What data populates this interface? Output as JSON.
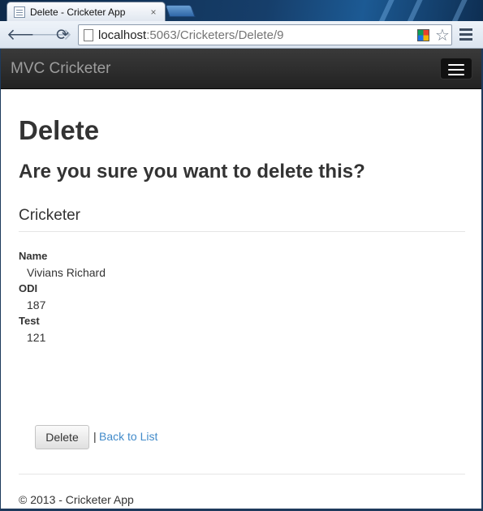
{
  "browser": {
    "tab_title": "Delete - Cricketer App",
    "tab_close": "×",
    "url_host": "localhost",
    "url_path": ":5063/Cricketers/Delete/9",
    "back_glyph": "🡐",
    "forward_glyph": "🡒",
    "reload_glyph": "⟳",
    "star_glyph": "☆",
    "icons": [
      "page-icon",
      "back-arrow-icon",
      "forward-arrow-icon",
      "reload-icon",
      "extension-icon",
      "bookmark-star-icon",
      "menu-icon"
    ]
  },
  "navbar": {
    "brand": "MVC Cricketer",
    "toggle_icon": "hamburger-menu-icon",
    "background": "#222222",
    "brand_color": "#9d9d9d"
  },
  "page": {
    "heading": "Delete",
    "confirm_question": "Are you sure you want to delete this?",
    "entity_title": "Cricketer",
    "fields": [
      {
        "label": "Name",
        "value": "Vivians Richard"
      },
      {
        "label": "ODI",
        "value": "187"
      },
      {
        "label": "Test",
        "value": "121"
      }
    ],
    "delete_button": "Delete",
    "separator": "|",
    "back_link": "Back to List",
    "link_color": "#428bca"
  },
  "footer": {
    "text": "© 2013 - Cricketer App"
  }
}
